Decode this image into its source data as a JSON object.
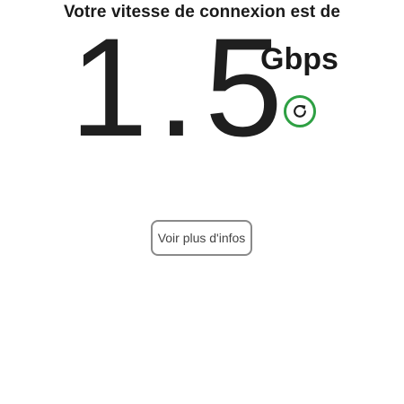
{
  "heading": "Votre vitesse de connexion est de",
  "speed": {
    "value": "1.5",
    "unit": "Gbps"
  },
  "refresh": {
    "icon": "refresh-icon",
    "color": "#2ea043"
  },
  "more_info_button": {
    "label": "Voir plus d'infos"
  }
}
